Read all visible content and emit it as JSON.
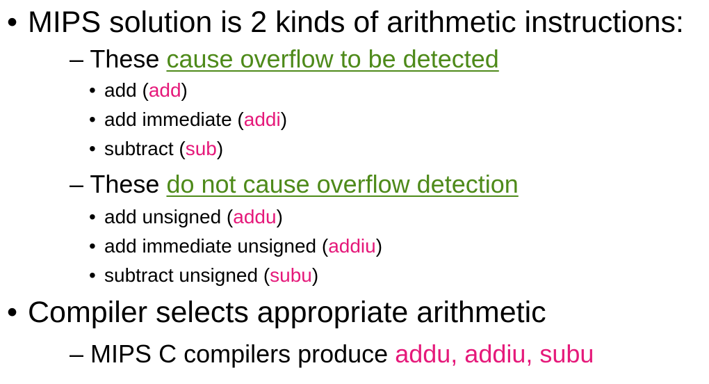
{
  "items": [
    {
      "level": 1,
      "bullet": "•",
      "text": "MIPS solution is 2 kinds of arithmetic instructions:"
    },
    {
      "level": 2,
      "bullet": "–",
      "text": "These ",
      "highlight": "cause overflow to be detected"
    },
    {
      "level": 3,
      "bullet": "•",
      "text": "add (",
      "code": "add",
      "tail": ")"
    },
    {
      "level": 3,
      "bullet": "•",
      "text": "add immediate (",
      "code": "addi",
      "tail": ")"
    },
    {
      "level": 3,
      "bullet": "•",
      "text": "subtract (",
      "code": "sub",
      "tail": ")"
    },
    {
      "level": 2,
      "bullet": "–",
      "text": "These ",
      "highlight": "do not cause overflow detection"
    },
    {
      "level": 3,
      "bullet": "•",
      "text": "add unsigned (",
      "code": "addu",
      "tail": ")"
    },
    {
      "level": 3,
      "bullet": "•",
      "text": "add immediate unsigned (",
      "code": "addiu",
      "tail": ")"
    },
    {
      "level": 3,
      "bullet": "•",
      "text": "subtract unsigned (",
      "code": "subu",
      "tail": ")"
    },
    {
      "level": 1,
      "bullet": "•",
      "text": "Compiler selects appropriate arithmetic"
    },
    {
      "level": 2,
      "bullet": "–",
      "text": "MIPS C compilers produce ",
      "code": "addu, addiu, subu"
    }
  ],
  "colors": {
    "highlight": "#4e8a1a",
    "code": "#e5197a"
  }
}
